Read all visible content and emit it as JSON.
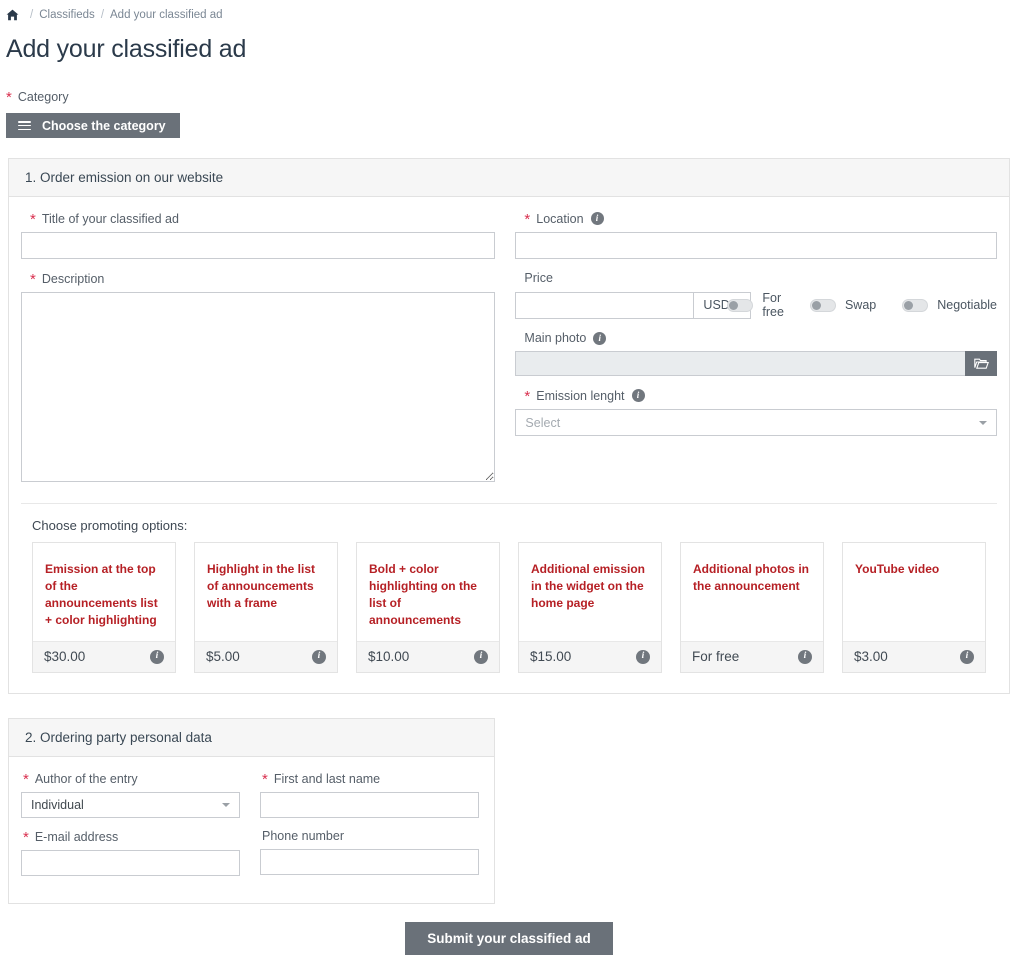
{
  "breadcrumb": {
    "home_icon": "home-icon",
    "separator": "/",
    "items": [
      {
        "label": "Classifieds"
      },
      {
        "label": "Add your classified ad"
      }
    ]
  },
  "page_title": "Add your classified ad",
  "category": {
    "label": "Category",
    "required_mark": "*",
    "button_label": "Choose the category",
    "button_icon": "hamburger-menu-icon"
  },
  "section1": {
    "heading": "1. Order emission on our website",
    "title_field": {
      "label": "Title of your classified ad",
      "required_mark": "*",
      "value": "",
      "placeholder": ""
    },
    "description_field": {
      "label": "Description",
      "required_mark": "*",
      "value": "",
      "placeholder": ""
    },
    "location_field": {
      "label": "Location",
      "required_mark": "*",
      "info_icon": "info-icon",
      "value": "",
      "placeholder": ""
    },
    "price_field": {
      "label": "Price",
      "value": "",
      "placeholder": "",
      "currency": "USD",
      "currency_caret": "caret-down-icon"
    },
    "toggles": [
      {
        "label": "For free",
        "state": "off"
      },
      {
        "label": "Swap",
        "state": "off"
      },
      {
        "label": "Negotiable",
        "state": "off"
      }
    ],
    "main_photo_field": {
      "label": "Main photo",
      "info_icon": "info-icon",
      "value": "",
      "browse_icon": "open-folder-icon"
    },
    "emission_length_field": {
      "label": "Emission lenght",
      "required_mark": "*",
      "info_icon": "info-icon",
      "selected": "Select",
      "caret": "caret-down-icon"
    },
    "promoting": {
      "title": "Choose promoting options:",
      "options": [
        {
          "title": "Emission at the top of the announcements list + color highlighting",
          "price": "$30.00",
          "info_icon": "info-icon"
        },
        {
          "title": "Highlight in the list of announcements with a frame",
          "price": "$5.00",
          "info_icon": "info-icon"
        },
        {
          "title": "Bold + color highlighting on the list of announcements",
          "price": "$10.00",
          "info_icon": "info-icon"
        },
        {
          "title": "Additional emission in the widget on the home page",
          "price": "$15.00",
          "info_icon": "info-icon"
        },
        {
          "title": "Additional photos in the announcement",
          "price": "For free",
          "info_icon": "info-icon"
        },
        {
          "title": "YouTube video",
          "price": "$3.00",
          "info_icon": "info-icon"
        }
      ]
    }
  },
  "section2": {
    "heading": "2. Ordering party personal data",
    "author_field": {
      "label": "Author of the entry",
      "required_mark": "*",
      "selected": "Individual",
      "caret": "caret-down-icon"
    },
    "name_field": {
      "label": "First and last name",
      "required_mark": "*",
      "value": "",
      "placeholder": ""
    },
    "email_field": {
      "label": "E-mail address",
      "required_mark": "*",
      "value": "",
      "placeholder": ""
    },
    "phone_field": {
      "label": "Phone number",
      "value": "",
      "placeholder": ""
    }
  },
  "submit": {
    "label": "Submit your classified ad"
  },
  "colors": {
    "accent_red": "#b62025",
    "required_star": "#d9304f",
    "button_gray": "#6a7179",
    "panel_head": "#f6f6f6",
    "title_navy": "#2b3a4a"
  }
}
